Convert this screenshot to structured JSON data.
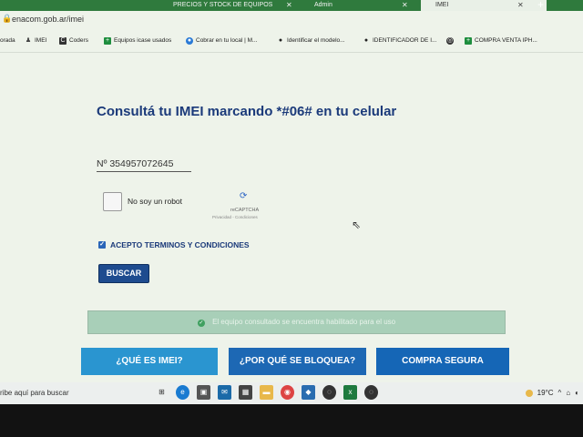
{
  "browser": {
    "tabs": [
      {
        "label": "PRECIOS Y STOCK DE EQUIPOS",
        "active": false
      },
      {
        "label": "Admin",
        "active": false
      },
      {
        "label": "IMEI",
        "active": true
      }
    ],
    "new_tab": "+",
    "url": "enacom.gob.ar/imei",
    "bookmarks": [
      {
        "label": "orada",
        "icon": "folder-icon"
      },
      {
        "label": "IMEI",
        "icon": "imei-icon"
      },
      {
        "label": "Coders",
        "icon": "coders-icon"
      },
      {
        "label": "Equipos icase usados",
        "icon": "sheets-icon"
      },
      {
        "label": "Cobrar en tu local | M...",
        "icon": "mercadopago-icon"
      },
      {
        "label": "Identificar el modelo...",
        "icon": "apple-icon"
      },
      {
        "label": "IDENTIFICADOR DE I...",
        "icon": "apple-icon"
      },
      {
        "label": "",
        "icon": "globe-icon"
      },
      {
        "label": "COMPRA VENTA IPH...",
        "icon": "sheets-icon"
      }
    ]
  },
  "page": {
    "title": "Consultá tu IMEI marcando *#06# en tu celular",
    "imei_prefix": "Nº",
    "imei_value": "354957072645",
    "captcha_label": "No soy un robot",
    "captcha_brand": "reCAPTCHA",
    "captcha_links": "Privacidad - Condiciones",
    "terms_label": "ACEPTO TERMINOS Y CONDICIONES",
    "search_button": "BUSCAR",
    "result_message": "El equipo consultado se encuentra habilitado para el uso",
    "nav_buttons": [
      "¿QUÉ ES IMEI?",
      "¿POR QUÉ SE BLOQUEA?",
      "COMPRA SEGURA"
    ]
  },
  "taskbar": {
    "search_placeholder": "ribe aquí para buscar",
    "temperature": "19°C",
    "colors": {
      "accent": "#1e4b8f",
      "nav_blue": "#2b8cd0",
      "success_bar": "#a8cfb8"
    }
  }
}
